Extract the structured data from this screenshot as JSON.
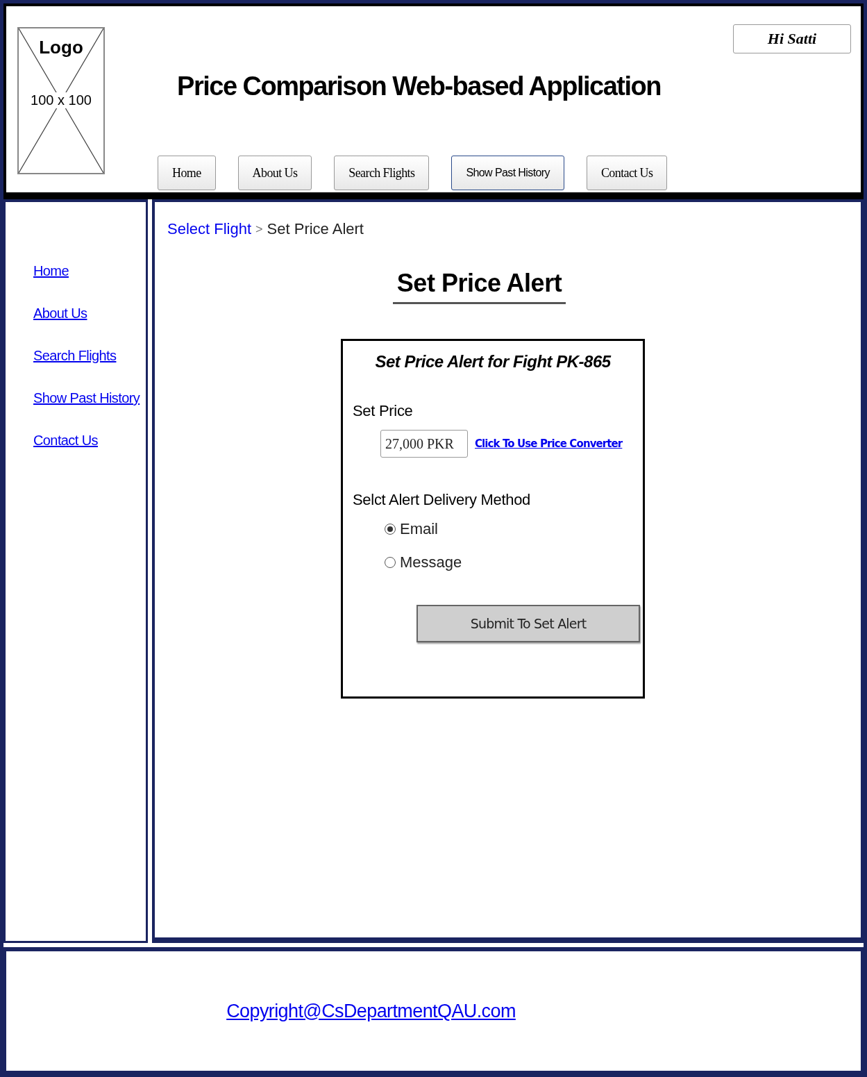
{
  "header": {
    "logo": {
      "label": "Logo",
      "size": "100 x 100"
    },
    "title": "Price Comparison Web-based Application",
    "greeting": "Hi Satti",
    "nav": [
      {
        "label": "Home",
        "selected": false
      },
      {
        "label": "About Us",
        "selected": false
      },
      {
        "label": "Search Flights",
        "selected": false
      },
      {
        "label": "Show Past History",
        "selected": true
      },
      {
        "label": "Contact Us",
        "selected": false
      }
    ]
  },
  "sidebar": {
    "items": [
      "Home",
      "About Us",
      "Search Flights",
      "Show Past History",
      "Contact Us"
    ]
  },
  "breadcrumb": {
    "link": "Select Flight",
    "separator": ">",
    "current": "Set Price Alert"
  },
  "page_title": "Set Price Alert",
  "form": {
    "title": "Set Price Alert for Fight PK-865",
    "price_label": "Set Price",
    "price_value": "27,000 PKR",
    "converter_link": "Click To Use Price Converter",
    "method_label": "Selct Alert Delivery Method",
    "methods": [
      {
        "label": "Email",
        "selected": true
      },
      {
        "label": "Message",
        "selected": false
      }
    ],
    "submit": "Submit To Set Alert"
  },
  "footer": {
    "copyright": "Copyright@CsDepartmentQAU.com"
  }
}
